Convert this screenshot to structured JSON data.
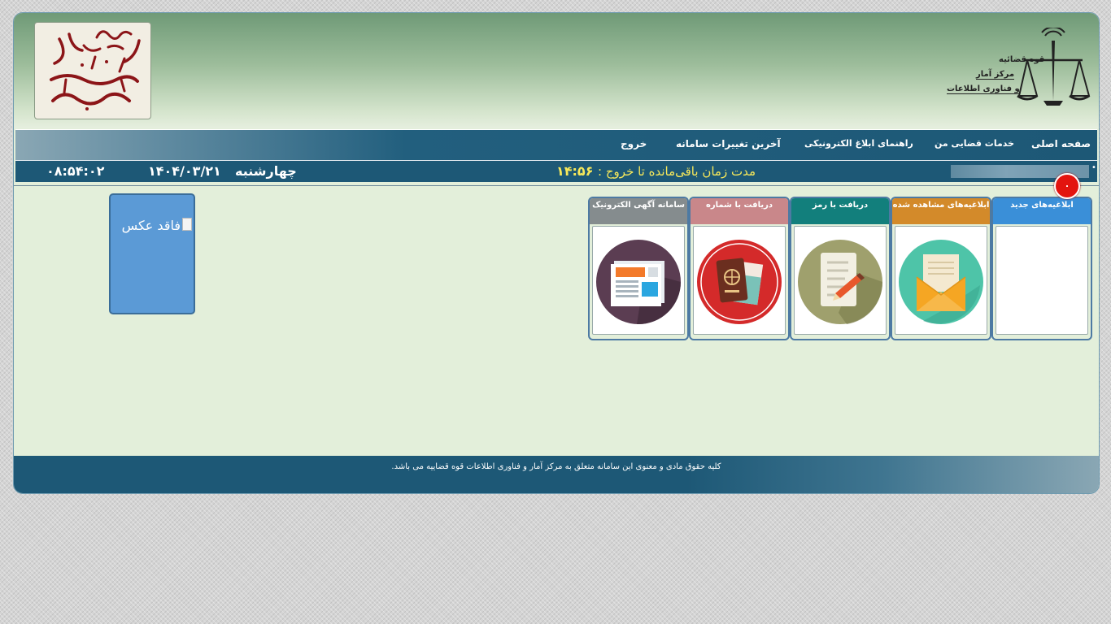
{
  "header": {
    "logo_left_text": "سامانه ابلاغ الکترونیک قضایی",
    "logo_right": {
      "line1": "قوه قضائیه",
      "line2": "مرکز آمار",
      "line3": "و فناوری اطلاعات"
    }
  },
  "nav": {
    "items": [
      {
        "label": "صفحه اصلی"
      },
      {
        "label": "خدمات قضایی من"
      },
      {
        "label": "راهنمای ابلاغ الکترونیکی"
      },
      {
        "label": "آخرین تغییرات سامانه"
      },
      {
        "label": "خروج"
      }
    ]
  },
  "status": {
    "timer_label": "مدت زمان باقی‌مانده تا خروج :",
    "timer_value": "۱۴:۵۶",
    "weekday": "چهارشنبه",
    "date": "۱۴۰۴/۰۳/۲۱",
    "time": "۰۸:۵۴:۰۲"
  },
  "cards": [
    {
      "title": "ابلاغیه‌های جدید",
      "color": "#3a8fd8",
      "icon": "empty"
    },
    {
      "title": "ابلاغیه‌های مشاهده شده",
      "color": "#d38a2a",
      "icon": "open-envelope-icon"
    },
    {
      "title": "دریافت با رمز",
      "color": "#127f7c",
      "icon": "document-pencil-icon"
    },
    {
      "title": "دریافت با شماره",
      "color": "#c9878a",
      "icon": "passport-icon"
    },
    {
      "title": "سامانه آگهی الکترونیک",
      "color": "#858c8e",
      "icon": "newspaper-icon"
    }
  ],
  "badge": {
    "count": "۰",
    "color": "#e3140f"
  },
  "photo": {
    "alt": "فاقد عکس",
    "color": "#5b9ad6"
  },
  "footer": {
    "text": "کلیه حقوق مادی و معنوی این سامانه متعلق به مرکز آمار و فناوری اطلاعات قوه قضاییه می باشد."
  }
}
